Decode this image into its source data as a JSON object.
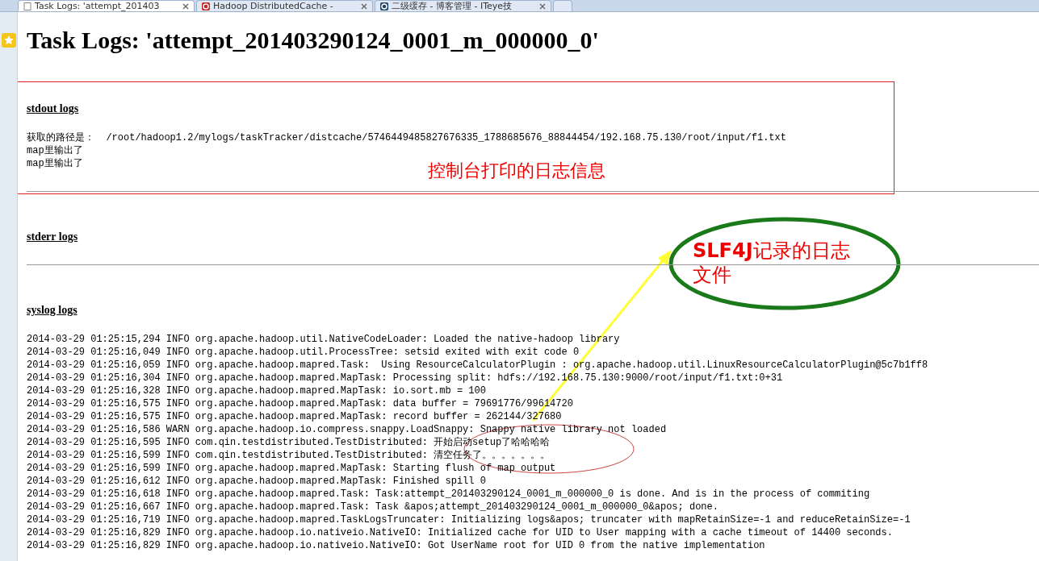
{
  "tabs": [
    {
      "title": "Task Logs: 'attempt_201403",
      "selected": true
    },
    {
      "title": "Hadoop DistributedCache -",
      "selected": false
    },
    {
      "title": "二级缓存 - 博客管理 - ITeye技",
      "selected": false
    }
  ],
  "title": "Task Logs: 'attempt_201403290124_0001_m_000000_0'",
  "sections": [
    {
      "heading": "stdout logs",
      "lines": [
        "获取的路径是：  /root/hadoop1.2/mylogs/taskTracker/distcache/5746449485827676335_1788685676_88844454/192.168.75.130/root/input/f1.txt",
        "map里输出了",
        "map里输出了"
      ]
    },
    {
      "heading": "stderr logs"
    },
    {
      "heading": "syslog logs",
      "lines": [
        "2014-03-29 01:25:15,294 INFO org.apache.hadoop.util.NativeCodeLoader: Loaded the native-hadoop library",
        "2014-03-29 01:25:16,049 INFO org.apache.hadoop.util.ProcessTree: setsid exited with exit code 0",
        "2014-03-29 01:25:16,059 INFO org.apache.hadoop.mapred.Task:  Using ResourceCalculatorPlugin : org.apache.hadoop.util.LinuxResourceCalculatorPlugin@5c7b1ff8",
        "2014-03-29 01:25:16,304 INFO org.apache.hadoop.mapred.MapTask: Processing split: hdfs://192.168.75.130:9000/root/input/f1.txt:0+31",
        "2014-03-29 01:25:16,328 INFO org.apache.hadoop.mapred.MapTask: io.sort.mb = 100",
        "2014-03-29 01:25:16,575 INFO org.apache.hadoop.mapred.MapTask: data buffer = 79691776/99614720",
        "2014-03-29 01:25:16,575 INFO org.apache.hadoop.mapred.MapTask: record buffer = 262144/327680",
        "2014-03-29 01:25:16,586 WARN org.apache.hadoop.io.compress.snappy.LoadSnappy: Snappy native library not loaded",
        "2014-03-29 01:25:16,595 INFO com.qin.testdistributed.TestDistributed: 开始启动setup了哈哈哈哈",
        "2014-03-29 01:25:16,599 INFO com.qin.testdistributed.TestDistributed: 清空任务了。。。。。。。",
        "2014-03-29 01:25:16,599 INFO org.apache.hadoop.mapred.MapTask: Starting flush of map output",
        "2014-03-29 01:25:16,612 INFO org.apache.hadoop.mapred.MapTask: Finished spill 0",
        "2014-03-29 01:25:16,618 INFO org.apache.hadoop.mapred.Task: Task:attempt_201403290124_0001_m_000000_0 is done. And is in the process of commiting",
        "2014-03-29 01:25:16,667 INFO org.apache.hadoop.mapred.Task: Task &apos;attempt_201403290124_0001_m_000000_0&apos; done.",
        "2014-03-29 01:25:16,719 INFO org.apache.hadoop.mapred.TaskLogsTruncater: Initializing logs&apos; truncater with mapRetainSize=-1 and reduceRetainSize=-1",
        "2014-03-29 01:25:16,829 INFO org.apache.hadoop.io.nativeio.NativeIO: Initialized cache for UID to User mapping with a cache timeout of 14400 seconds.",
        "2014-03-29 01:25:16,829 INFO org.apache.hadoop.io.nativeio.NativeIO: Got UserName root for UID 0 from the native implementation"
      ]
    }
  ],
  "annotations": {
    "console_note": "控制台打印的日志信息",
    "slf4j_note": "**SLF4J**记录的日志文件"
  }
}
